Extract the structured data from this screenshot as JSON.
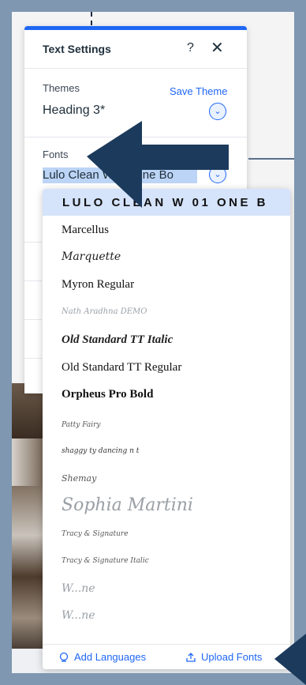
{
  "panel": {
    "title": "Text Settings",
    "help_label": "?",
    "close_label": "✕",
    "themes_label": "Themes",
    "save_theme_label": "Save Theme",
    "theme_value": "Heading 3*",
    "fonts_label": "Fonts",
    "font_value": "Lulo Clean W 01 One Bo"
  },
  "dropdown": {
    "selected": "LULO CLEAN W 01 ONE B",
    "items": [
      "Marcellus",
      "Marquette",
      "Myron Regular",
      "Nath Aradhna DEMO",
      "Old Standard TT Italic",
      "Old Standard TT Regular",
      "Orpheus Pro Bold",
      "Patty Fairy",
      "shaggy ty dancing n t",
      "Shemay",
      "Sophia Martini",
      "Tracy & Signature",
      "Tracy & Signature Italic",
      "W...ne",
      "W...ne"
    ],
    "footer": {
      "add_languages": "Add Languages",
      "upload_fonts": "Upload Fonts"
    }
  },
  "colors": {
    "accent": "#1f67f4",
    "selected_bg": "#d5e3fb",
    "arrow": "#1c3a5c",
    "frame": "#7f97b0"
  }
}
